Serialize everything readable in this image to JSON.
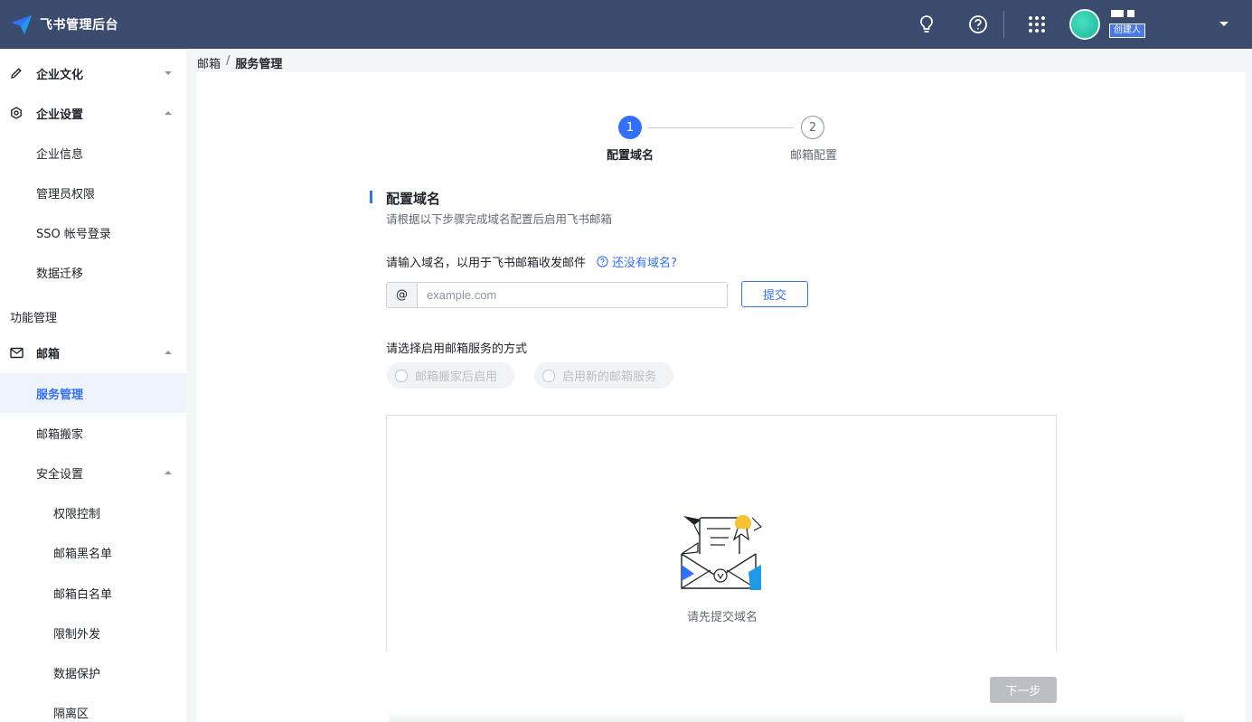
{
  "app": {
    "title": "飞书管理后台"
  },
  "header": {
    "role_badge": "创建人"
  },
  "sidebar": {
    "items": [
      {
        "label": "企业文化"
      },
      {
        "label": "企业设置"
      },
      {
        "label": "企业信息"
      },
      {
        "label": "管理员权限"
      },
      {
        "label": "SSO 帐号登录"
      },
      {
        "label": "数据迁移"
      },
      {
        "label": "邮箱"
      },
      {
        "label": "服务管理"
      },
      {
        "label": "邮箱搬家"
      },
      {
        "label": "安全设置"
      },
      {
        "label": "权限控制"
      },
      {
        "label": "邮箱黑名单"
      },
      {
        "label": "邮箱白名单"
      },
      {
        "label": "限制外发"
      },
      {
        "label": "数据保护"
      },
      {
        "label": "隔离区"
      }
    ],
    "section_label": "功能管理"
  },
  "breadcrumb": {
    "parent": "邮箱",
    "separator": "/",
    "current": "服务管理"
  },
  "steps": [
    {
      "number": "1",
      "label": "配置域名"
    },
    {
      "number": "2",
      "label": "邮箱配置"
    }
  ],
  "section": {
    "title": "配置域名",
    "subtitle": "请根据以下步骤完成域名配置后启用飞书邮箱"
  },
  "domain": {
    "label": "请输入域名，以用于飞书邮箱收发邮件",
    "no_domain_link": "还没有域名?",
    "prefix": "@",
    "placeholder": "example.com",
    "value": "",
    "submit_label": "提交"
  },
  "mode": {
    "label": "请选择启用邮箱服务的方式",
    "options": [
      "邮箱搬家后启用",
      "启用新的邮箱服务"
    ]
  },
  "empty_state": {
    "text": "请先提交域名"
  },
  "footer": {
    "next_label": "下一步"
  },
  "colors": {
    "topbar": "#3b4b6e",
    "accent": "#3370ff",
    "active_bg": "#eef3fd"
  }
}
